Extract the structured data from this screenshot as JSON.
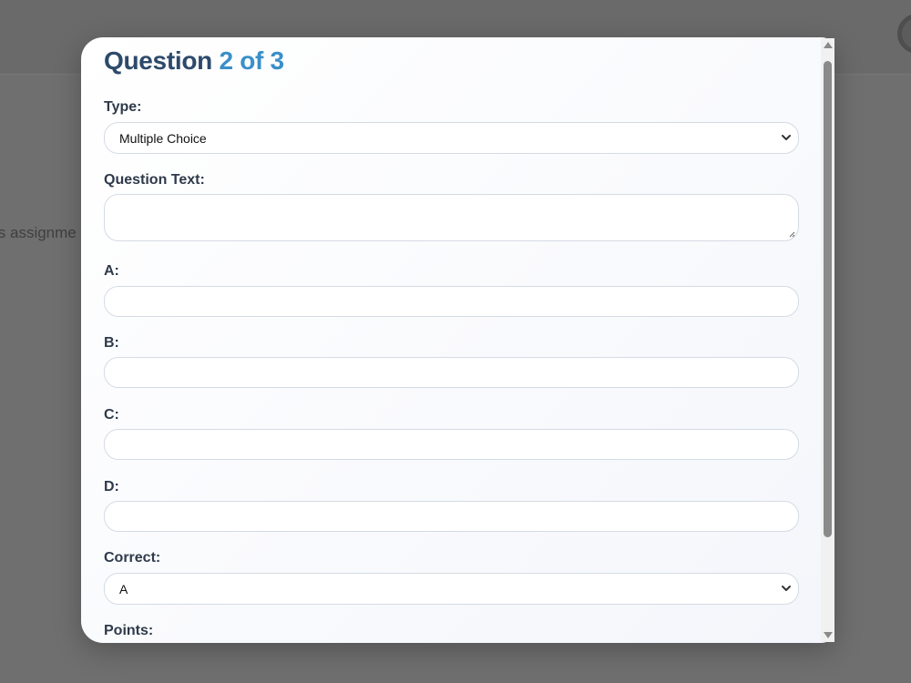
{
  "background": {
    "partial_text": "ls assignme"
  },
  "modal": {
    "title_prefix": "Question",
    "title_current": "2",
    "title_of": "of",
    "title_total": "3",
    "type_label": "Type:",
    "type_value": "Multiple Choice",
    "question_text_label": "Question Text:",
    "question_text_value": "",
    "option_a_label": "A:",
    "option_b_label": "B:",
    "option_c_label": "C:",
    "option_d_label": "D:",
    "option_a_value": "",
    "option_b_value": "",
    "option_c_value": "",
    "option_d_value": "",
    "correct_label": "Correct:",
    "correct_value": "A",
    "points_label": "Points:"
  },
  "colors": {
    "title": "#2d4a6b",
    "accent": "#3a8fc9",
    "label": "#2f3a4a",
    "overlay": "#6c6c6c"
  }
}
